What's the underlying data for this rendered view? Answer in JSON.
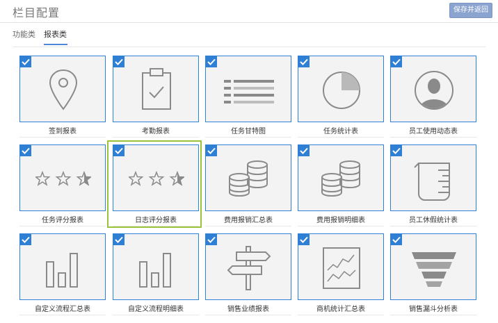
{
  "header": {
    "title": "栏目配置",
    "save_label": "保存并返回"
  },
  "tabs": [
    {
      "label": "功能类"
    },
    {
      "label": "报表类"
    }
  ],
  "active_tab": "报表类",
  "colors": {
    "accent": "#2f7fd4",
    "highlight": "#9bc33a",
    "button": "#8ba3cf"
  },
  "cards": [
    {
      "label": "签到报表",
      "icon": "location-pin-icon",
      "checked": true
    },
    {
      "label": "考勤报表",
      "icon": "clipboard-check-icon",
      "checked": true
    },
    {
      "label": "任务甘特图",
      "icon": "gantt-list-icon",
      "checked": true
    },
    {
      "label": "任务统计表",
      "icon": "pie-chart-icon",
      "checked": true
    },
    {
      "label": "员工使用动态表",
      "icon": "user-avatar-icon",
      "checked": true
    },
    {
      "label": "任务评分报表",
      "icon": "star-rating-icon",
      "checked": true
    },
    {
      "label": "日志评分报表",
      "icon": "star-rating-icon",
      "checked": true,
      "highlighted": true
    },
    {
      "label": "费用报销汇总表",
      "icon": "coin-stack-icon",
      "checked": true
    },
    {
      "label": "费用报销明细表",
      "icon": "coin-stack-icon",
      "checked": true
    },
    {
      "label": "员工休假统计表",
      "icon": "measuring-cup-icon",
      "checked": true
    },
    {
      "label": "自定义流程汇总表",
      "icon": "bar-chart-icon",
      "checked": true
    },
    {
      "label": "自定义流程明细表",
      "icon": "bar-chart-icon",
      "checked": true
    },
    {
      "label": "销售业绩报表",
      "icon": "signpost-icon",
      "checked": true
    },
    {
      "label": "商机统计汇总表",
      "icon": "line-chart-icon",
      "checked": true
    },
    {
      "label": "销售漏斗分析表",
      "icon": "sales-funnel-icon",
      "checked": true
    }
  ]
}
